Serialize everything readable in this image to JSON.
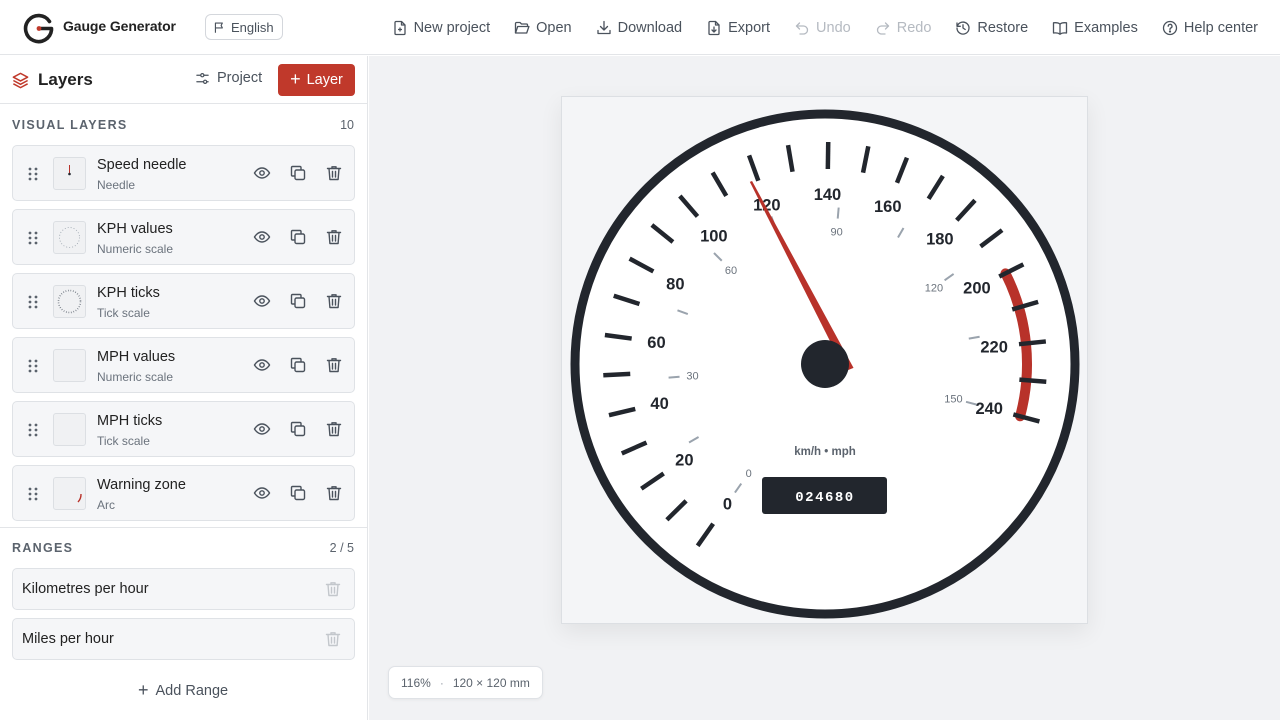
{
  "app": {
    "title": "Gauge Generator",
    "language": "English"
  },
  "toolbar": {
    "items": [
      {
        "label": "New project",
        "icon": "file-plus-icon",
        "enabled": true
      },
      {
        "label": "Open",
        "icon": "folder-open-icon",
        "enabled": true
      },
      {
        "label": "Download",
        "icon": "download-icon",
        "enabled": true
      },
      {
        "label": "Export",
        "icon": "file-export-icon",
        "enabled": true
      },
      {
        "label": "Undo",
        "icon": "undo-icon",
        "enabled": false
      },
      {
        "label": "Redo",
        "icon": "redo-icon",
        "enabled": false
      },
      {
        "label": "Restore",
        "icon": "history-icon",
        "enabled": true
      },
      {
        "label": "Examples",
        "icon": "book-open-icon",
        "enabled": true
      },
      {
        "label": "Help center",
        "icon": "help-circle-icon",
        "enabled": true
      }
    ]
  },
  "sidebar": {
    "title": "Layers",
    "project_label": "Project",
    "add_layer_label": "Layer",
    "visual_layers_label": "VISUAL LAYERS",
    "visual_layers_count": "10",
    "layers": [
      {
        "name": "Speed needle",
        "type": "Needle"
      },
      {
        "name": "KPH values",
        "type": "Numeric scale"
      },
      {
        "name": "KPH ticks",
        "type": "Tick scale"
      },
      {
        "name": "MPH values",
        "type": "Numeric scale"
      },
      {
        "name": "MPH ticks",
        "type": "Tick scale"
      },
      {
        "name": "Warning zone",
        "type": "Arc"
      }
    ],
    "ranges_label": "RANGES",
    "ranges_count": "2 / 5",
    "ranges": [
      {
        "name": "Kilometres per hour"
      },
      {
        "name": "Miles per hour"
      }
    ],
    "add_range_label": "Add Range"
  },
  "gauge": {
    "kph_labels": [
      "0",
      "20",
      "40",
      "60",
      "80",
      "100",
      "120",
      "140",
      "160",
      "180",
      "200",
      "220",
      "240"
    ],
    "mph_labels": [
      "0",
      "30",
      "60",
      "90",
      "120",
      "150"
    ],
    "kph_max": 240,
    "mph_max": 150,
    "needle_value_kph": 118,
    "warning_zone_kph": [
      200,
      240
    ],
    "unit_label": "km/h • mph",
    "odometer": "024680",
    "colors": {
      "ring": "#22262d",
      "needle": "#b8322a",
      "warning": "#b8322a",
      "minor_tick": "#9aa3ad"
    }
  },
  "canvas": {
    "zoom": "116%",
    "size": "120 × 120 mm"
  },
  "theme": {
    "accent": "#c0392b"
  }
}
